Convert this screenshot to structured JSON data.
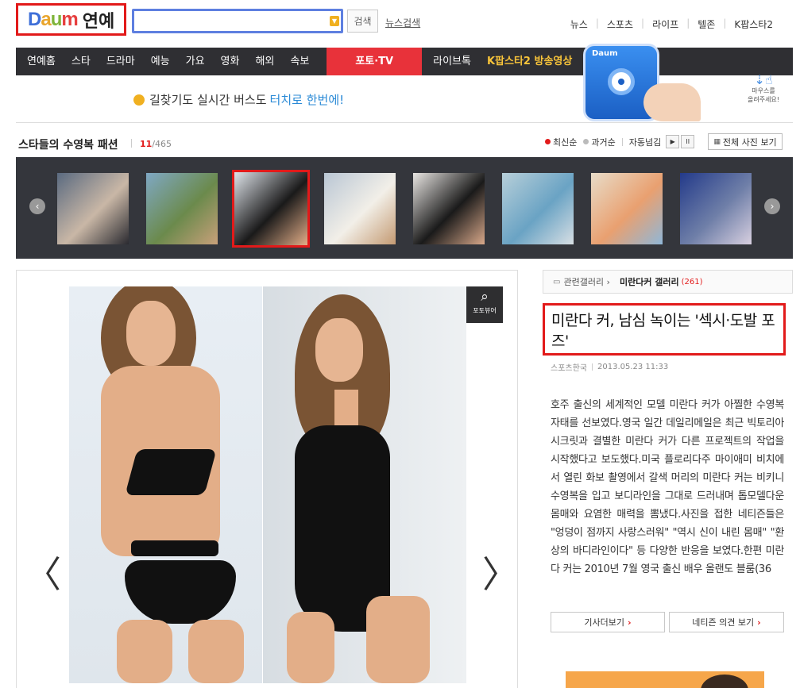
{
  "header": {
    "logo_text": "Daum",
    "logo_sub": "연예",
    "search_placeholder": "",
    "search_button": "검색",
    "news_search": "뉴스검색",
    "top_links": [
      "뉴스",
      "스포츠",
      "라이프",
      "텔존",
      "K팝스타2"
    ]
  },
  "nav": {
    "items": [
      "연예홈",
      "스타",
      "드라마",
      "예능",
      "가요",
      "영화",
      "해외",
      "속보"
    ],
    "active": "포토·TV",
    "extra": "라이브톡",
    "highlight": "K팝스타2 방송영상"
  },
  "banner": {
    "text_main": "길찾기도 실시간 버스도",
    "text_accent": "터치로 한번에!",
    "app_brand": "Daum",
    "mouse_hint_line1": "마우스를",
    "mouse_hint_line2": "올려주세요!"
  },
  "gallery": {
    "title": "스타들의 수영복 패션",
    "current": "11",
    "total": "/465",
    "sort_latest": "최신순",
    "sort_past": "과거순",
    "autoplay": "자동넘김",
    "play_symbol": "▶",
    "pause_symbol": "II",
    "all_photos": "전체 사진 보기"
  },
  "thumbnails": [
    {
      "colors": [
        "#5a6a80",
        "#c9b7a6",
        "#2a2a30"
      ]
    },
    {
      "colors": [
        "#7fa8c4",
        "#6b8a4c",
        "#c8a07a"
      ]
    },
    {
      "colors": [
        "#dfe4ea",
        "#1a1a1a",
        "#e3ae88"
      ]
    },
    {
      "colors": [
        "#b9c6d4",
        "#f2efe8",
        "#c49a72"
      ]
    },
    {
      "colors": [
        "#e9e6e3",
        "#1a1a1a",
        "#d8a88a"
      ]
    },
    {
      "colors": [
        "#b7cfd9",
        "#6aa3c4",
        "#d8dfe4"
      ]
    },
    {
      "colors": [
        "#e8dcc8",
        "#e9a070",
        "#8fb7d8"
      ]
    },
    {
      "colors": [
        "#233a8a",
        "#6f7fa8",
        "#d8d0e0"
      ]
    }
  ],
  "photo": {
    "viewer_label": "포토뷰어",
    "prev_symbol": "〈",
    "next_symbol": "〉"
  },
  "article": {
    "related_label": "관련갤러리 ›",
    "related_name": "미란다커 갤러리",
    "related_count": "(261)",
    "headline": "미란다 커, 남심 녹이는 '섹시·도발 포즈'",
    "source": "스포츠한국",
    "datetime": "2013.05.23 11:33",
    "body": "호주 출신의 세계적인 모델 미란다 커가 아찔한 수영복 자태를 선보였다.영국 일간 데일리메일은 최근 빅토리아 시크릿과 결별한 미란다 커가 다른 프로젝트의 작업을 시작했다고 보도했다.미국 플로리다주 마이애미 비치에서 열린 화보 촬영에서 갈색 머리의 미란다 커는 비키니 수영복을 입고 보디라인을 그대로 드러내며 톱모델다운 몸매와 요염한 매력을 뽐냈다.사진을 접한 네티즌들은 \"엉덩이 점까지 사랑스러워\" \"역시 신이 내린 몸매\" \"환상의 바디라인이다\" 등 다양한 반응을 보였다.한편 미란다 커는 2010년 7월 영국 출신 배우 올랜도 블룸(36",
    "more_button": "기사더보기",
    "comments_button": "네티즌 의견 보기"
  },
  "colors": {
    "accent_red": "#e21a1a",
    "nav_bg": "#2f2f33",
    "strip_bg": "#34363c",
    "highlight_yellow": "#f8c43a",
    "link_blue": "#2a8ad6"
  },
  "icons": [
    "search-dropdown-icon",
    "flower-icon",
    "magnifier-icon",
    "gallery-icon",
    "grid-icon",
    "arrow-left-icon",
    "arrow-right-icon",
    "mouse-hand-icon"
  ]
}
